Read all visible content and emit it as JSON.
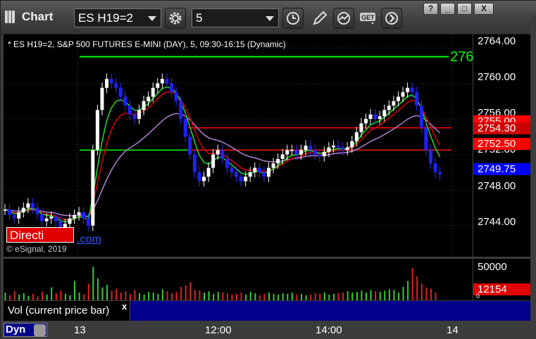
{
  "window": {
    "title": "Chart",
    "help_button": "?",
    "window_controls": [
      "?",
      "_",
      "□",
      "X"
    ]
  },
  "toolbar": {
    "symbol": "ES H19=2",
    "interval": "5",
    "icons": [
      "settings-gear-icon",
      "clock-icon",
      "pencil-icon",
      "study-icon",
      "get-icon",
      "forward-icon"
    ]
  },
  "chart_header": "* ES H19=2, S&P 500 FUTURES E-MINI (DAY), 5, 09:30-16:15 (Dynamic)",
  "watermark": {
    "brand": "DirectionNow.com",
    "brand_left": "Directi",
    "brand_right": ".com",
    "copyright": "© eSignal, 2019"
  },
  "price_axis": {
    "ticks": [
      "2764.00",
      "2760.00",
      "2756.00",
      "2752.00",
      "2748.00",
      "2744.00"
    ],
    "tags": [
      {
        "value": "2755.00",
        "color": "#ff0000"
      },
      {
        "value": "2754.30",
        "color": "#cc0000"
      },
      {
        "value": "2752.50",
        "color": "#ff0000"
      },
      {
        "value": "2749.75",
        "color": "#0000ff"
      }
    ],
    "level_label": "276"
  },
  "volume_panel": {
    "label": "Vol (current price bar)",
    "close": "x",
    "tick": "50000",
    "current": "12154",
    "zero": "0"
  },
  "time_axis": {
    "labels": [
      "13",
      "12:00",
      "14:00",
      "14"
    ],
    "dyn_label": "Dyn"
  },
  "colors": {
    "up_candle": "#ffffff",
    "down_candle": "#2020ff",
    "ma_fast": "#22dd22",
    "ma_slow": "#dd0000",
    "ma_mid": "#b080d0",
    "resistance": "#00ff00"
  },
  "chart_data": {
    "type": "line",
    "title": "",
    "xlabel": "",
    "ylabel": "",
    "ylim": [
      2740.5,
      2765.5
    ],
    "x": [
      0,
      1,
      2,
      3,
      4,
      5,
      6,
      7,
      8,
      9,
      10,
      11,
      12,
      13,
      14,
      15,
      16,
      17,
      18,
      19,
      20,
      21,
      22,
      23,
      24,
      25,
      26,
      27,
      28,
      29,
      30,
      31,
      32,
      33,
      34,
      35,
      36,
      37,
      38,
      39,
      40,
      41,
      42,
      43,
      44,
      45,
      46,
      47,
      48,
      49,
      50,
      51,
      52,
      53,
      54,
      55,
      56,
      57,
      58,
      59,
      60,
      61,
      62,
      63,
      64,
      65,
      66,
      67,
      68,
      69,
      70,
      71,
      72,
      73,
      74,
      75,
      76,
      77,
      78,
      79,
      80,
      81,
      82,
      83,
      84,
      85,
      86,
      87,
      88,
      89,
      90,
      91,
      92,
      93,
      94,
      95,
      96,
      97,
      98,
      99,
      100,
      101
    ],
    "close": [
      2745.8,
      2745.2,
      2744.8,
      2745.5,
      2746.0,
      2746.5,
      2746.0,
      2745.3,
      2744.5,
      2744.8,
      2745.0,
      2744.5,
      2743.8,
      2744.2,
      2744.8,
      2745.2,
      2745.5,
      2744.8,
      2744.0,
      2752.5,
      2757.0,
      2759.5,
      2760.5,
      2760.0,
      2759.5,
      2758.5,
      2757.5,
      2756.5,
      2756.0,
      2757.0,
      2758.0,
      2758.5,
      2759.5,
      2760.0,
      2760.5,
      2760.0,
      2759.0,
      2758.0,
      2756.0,
      2754.0,
      2752.0,
      2750.0,
      2749.0,
      2749.5,
      2750.5,
      2752.0,
      2752.5,
      2751.5,
      2750.5,
      2750.0,
      2749.5,
      2749.0,
      2749.5,
      2750.0,
      2750.5,
      2750.0,
      2749.5,
      2750.5,
      2751.0,
      2751.5,
      2752.0,
      2752.5,
      2752.5,
      2752.0,
      2752.5,
      2753.0,
      2752.5,
      2752.0,
      2751.8,
      2752.3,
      2752.8,
      2753.0,
      2752.8,
      2752.5,
      2752.8,
      2753.5,
      2754.5,
      2755.5,
      2756.0,
      2756.5,
      2756.0,
      2756.3,
      2757.0,
      2757.5,
      2758.0,
      2758.5,
      2759.0,
      2759.5,
      2759.0,
      2757.5,
      2755.0,
      2752.5,
      2751.0,
      2750.0,
      2749.75
    ],
    "series": [
      {
        "name": "",
        "type": "candles"
      },
      {
        "name": "",
        "type": "ma"
      }
    ],
    "levels": [
      2763.0,
      2752.5,
      2755.0
    ],
    "volume": [
      12000,
      8000,
      14000,
      9000,
      11000,
      7000,
      10000,
      6000,
      13000,
      9000,
      20000,
      11000,
      15000,
      10000,
      8000,
      30000,
      12000,
      9000,
      26000,
      52000,
      34000,
      20000,
      24000,
      15000,
      18000,
      12000,
      14000,
      10000,
      16000,
      11000,
      9000,
      13000,
      12000,
      10000,
      17000,
      14000,
      11000,
      13000,
      21000,
      23000,
      28000,
      16000,
      15000,
      12000,
      14000,
      10000,
      13000,
      12000,
      11000,
      9000,
      10000,
      12000,
      9000,
      13000,
      11000,
      8000,
      10000,
      12000,
      10000,
      9000,
      11000,
      10000,
      12000,
      9000,
      10000,
      8000,
      9000,
      11000,
      10000,
      12000,
      9000,
      10000,
      11000,
      12000,
      14000,
      12000,
      13000,
      15000,
      12000,
      16000,
      14000,
      13000,
      15000,
      17000,
      16000,
      12000,
      21000,
      30000,
      50000,
      37000,
      26000,
      20000,
      18000,
      12154
    ]
  }
}
